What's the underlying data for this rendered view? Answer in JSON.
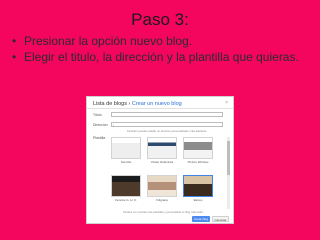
{
  "slide": {
    "title": "Paso 3:",
    "bullets": [
      "Presionar la opción nuevo blog.",
      "Elegir el titulo, la dirección y la plantilla que quieras."
    ],
    "bullet_glyph": "•"
  },
  "dialog": {
    "header_prefix": "Lista de blogs",
    "header_link": "Crear un nuevo blog",
    "close_glyph": "×",
    "title_label": "Título",
    "title_value": "",
    "address_label": "Dirección",
    "address_value": "|",
    "address_hint": "También puedes añadir un dominio personalizado más adelante.",
    "template_label": "Plantilla",
    "templates": [
      {
        "name": "Sencillo",
        "selected": false
      },
      {
        "name": "Vistas dinámicas",
        "selected": false
      },
      {
        "name": "Picture Window",
        "selected": false
      },
      {
        "name": "Fenêtre G. H. K.",
        "selected": false
      },
      {
        "name": "Filigrana",
        "selected": false
      },
      {
        "name": "Etéreo",
        "selected": true
      }
    ],
    "footnote": "Puedes ver muchas más plantillas y personalizar tu blog más tarde.",
    "create_button": "Crear blog",
    "cancel_button": "Cancelar"
  },
  "colors": {
    "background": "#f4065f",
    "link": "#2a6fd6",
    "primary_button": "#4d8af0"
  }
}
